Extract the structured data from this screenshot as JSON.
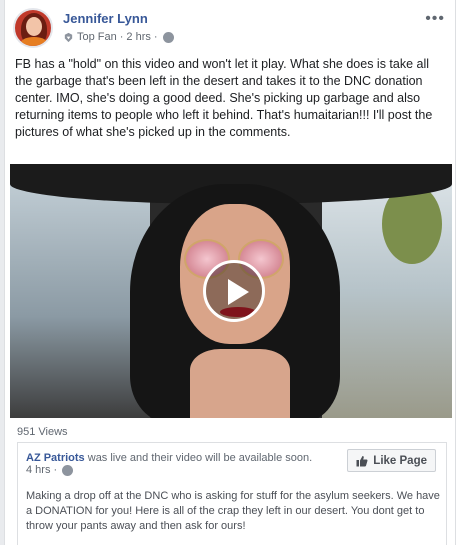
{
  "post": {
    "author": "Jennifer Lynn",
    "badge": "Top Fan",
    "separator": "·",
    "time": "2 hrs",
    "separator2": "·",
    "more": "•••",
    "text": "FB has a \"hold\" on this video and won't let it play. What she does is take all the garbage that's been left in the desert and takes it to the DNC donation center. IMO, she's doing a good deed. She's picking up garbage and also returning items to people who left it behind. That's humaitarian!!! I'll post the pictures of what she's picked up in the comments."
  },
  "video": {
    "views": "951 Views"
  },
  "shared": {
    "page_name": "AZ Patriots",
    "status": "was live and their video will be available soon.",
    "time": "4 hrs",
    "separator": "·",
    "like_button": "Like Page",
    "text": "Making a drop off at the DNC who is asking for stuff for the asylum seekers. We have a DONATION for you! Here is all of the crap they left in our desert. You dont get to throw your pants away and then ask for ours!"
  },
  "colors": {
    "link": "#385898",
    "meta": "#606770",
    "lips": "#c41e2a"
  }
}
